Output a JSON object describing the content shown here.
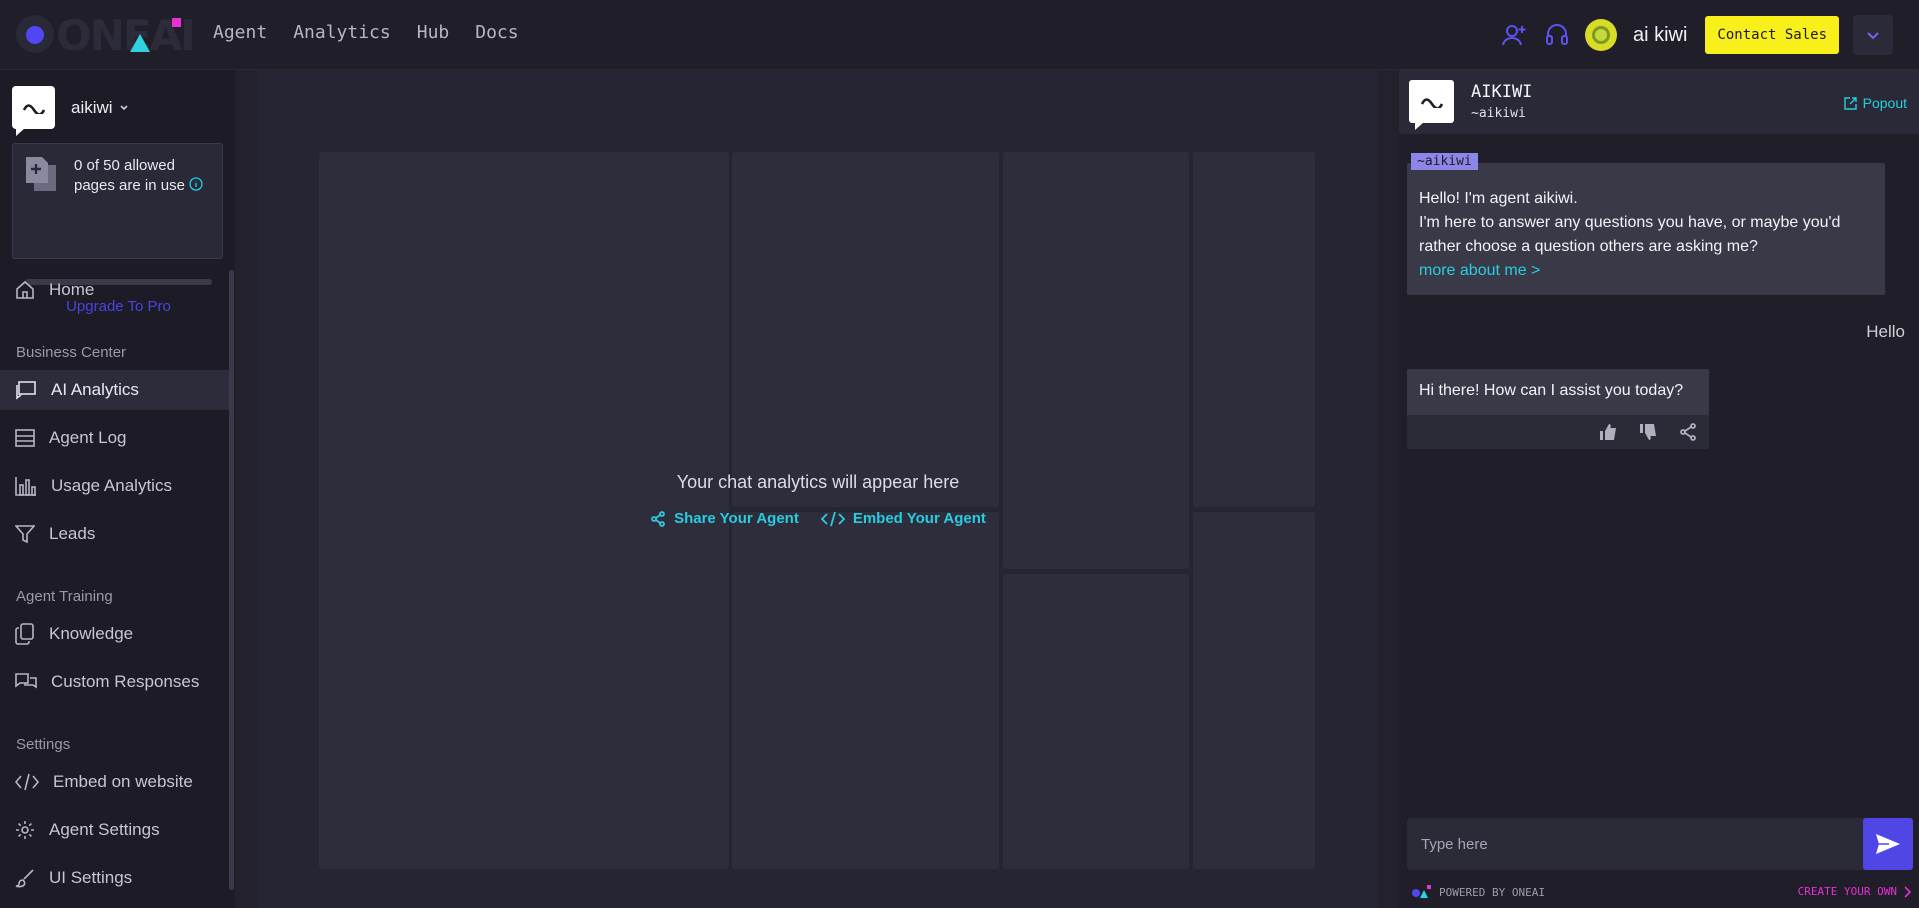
{
  "topbar": {
    "logo_text": "ONEAI",
    "nav": [
      "Agent",
      "Analytics",
      "Hub",
      "Docs"
    ],
    "user_name": "ai kiwi",
    "contact_label": "Contact Sales",
    "icons": [
      "add-user-icon",
      "headset-icon",
      "avatar",
      "chevron-down-icon"
    ]
  },
  "sidebar": {
    "agent_name": "aikiwi",
    "usage": {
      "text": "0 of 50 allowed pages are in use",
      "used": 0,
      "limit": 50,
      "upgrade_label": "Upgrade To Pro"
    },
    "home_label": "Home",
    "sections": [
      {
        "title": "Business Center",
        "items": [
          {
            "label": "AI Analytics",
            "icon": "chat-analytics-icon",
            "active": true
          },
          {
            "label": "Agent Log",
            "icon": "list-icon"
          },
          {
            "label": "Usage Analytics",
            "icon": "bar-chart-icon"
          },
          {
            "label": "Leads",
            "icon": "filter-icon"
          }
        ]
      },
      {
        "title": "Agent Training",
        "items": [
          {
            "label": "Knowledge",
            "icon": "documents-icon"
          },
          {
            "label": "Custom Responses",
            "icon": "chat-bubbles-icon"
          }
        ]
      },
      {
        "title": "Settings",
        "items": [
          {
            "label": "Embed on website",
            "icon": "code-icon"
          },
          {
            "label": "Agent Settings",
            "icon": "gear-icon"
          },
          {
            "label": "UI Settings",
            "icon": "brush-icon"
          }
        ]
      }
    ]
  },
  "main": {
    "placeholder_title": "Your chat analytics will appear here",
    "share_label": "Share Your Agent",
    "embed_label": "Embed Your Agent"
  },
  "chat": {
    "title": "AIKIWI",
    "subtitle": "~aikiwi",
    "popout_label": "Popout",
    "tag": "~aikiwi",
    "greeting_line1": "Hello! I'm agent aikiwi.",
    "greeting_line2": "I'm here to answer any questions you have, or maybe you'd rather choose a question others are asking me?",
    "more_label": "more about me >",
    "user_message": "Hello",
    "bot_reply": "Hi there! How can I assist you today?",
    "input_placeholder": "Type here",
    "powered_by": "POWERED BY ONEAI",
    "create_label": "CREATE YOUR OWN"
  },
  "colors": {
    "accent": "#4f46e5",
    "cyan": "#27cde0",
    "yellow": "#f8ef1b",
    "magenta": "#e92fd6"
  }
}
